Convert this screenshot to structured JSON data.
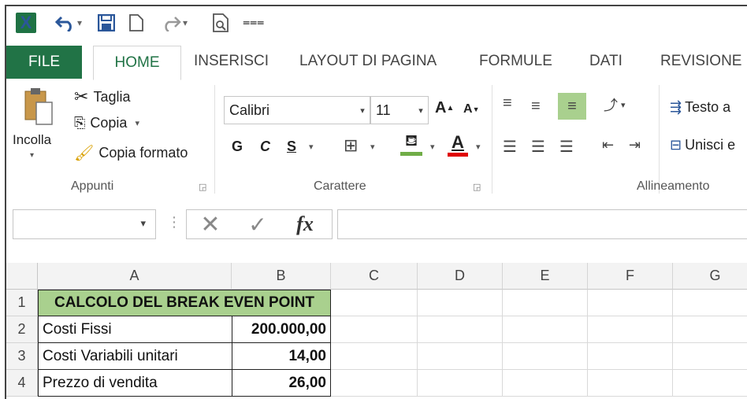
{
  "quick_access": {
    "logo": "X",
    "icons": [
      "excel-logo-icon",
      "undo-icon",
      "save-icon",
      "new-file-icon",
      "redo-icon",
      "print-preview-icon",
      "customize-icon"
    ]
  },
  "tabs": [
    {
      "label": "FILE"
    },
    {
      "label": "HOME"
    },
    {
      "label": "INSERISCI"
    },
    {
      "label": "LAYOUT DI PAGINA"
    },
    {
      "label": "FORMULE"
    },
    {
      "label": "DATI"
    },
    {
      "label": "REVISIONE"
    }
  ],
  "ribbon": {
    "clipboard": {
      "paste_label": "Incolla",
      "cut_label": "Taglia",
      "copy_label": "Copia",
      "format_painter_label": "Copia formato",
      "group_label": "Appunti"
    },
    "font": {
      "font_name": "Calibri",
      "font_size": "11",
      "bold_label": "G",
      "italic_label": "C",
      "underline_label": "S",
      "group_label": "Carattere",
      "fill_color": "#70ad47",
      "font_color": "#e00000"
    },
    "alignment": {
      "wrap_label": "Testo a",
      "merge_label": "Unisci e",
      "group_label": "Allineamento"
    }
  },
  "formula_bar": {
    "fx_label": "fx",
    "value": ""
  },
  "sheet": {
    "columns": [
      "A",
      "B",
      "C",
      "D",
      "E",
      "F",
      "G"
    ],
    "rows": [
      "1",
      "2",
      "3",
      "4"
    ],
    "header_fill": "#a9d08e",
    "cells": {
      "title": "CALCOLO DEL BREAK EVEN POINT",
      "a2": "Costi Fissi",
      "b2": "200.000,00",
      "a3": "Costi Variabili unitari",
      "b3": "14,00",
      "a4": "Prezzo di vendita",
      "b4": "26,00"
    }
  }
}
